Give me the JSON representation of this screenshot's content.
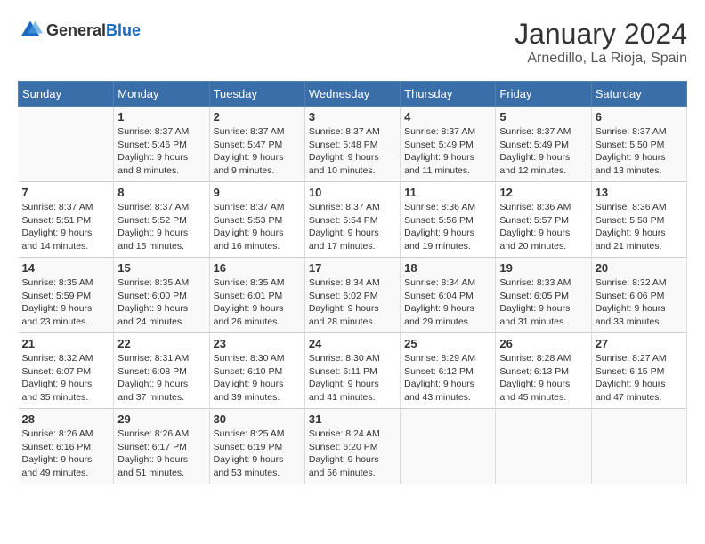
{
  "logo": {
    "text_general": "General",
    "text_blue": "Blue"
  },
  "title": "January 2024",
  "location": "Arnedillo, La Rioja, Spain",
  "weekdays": [
    "Sunday",
    "Monday",
    "Tuesday",
    "Wednesday",
    "Thursday",
    "Friday",
    "Saturday"
  ],
  "weeks": [
    [
      {
        "day": "",
        "info": ""
      },
      {
        "day": "1",
        "info": "Sunrise: 8:37 AM\nSunset: 5:46 PM\nDaylight: 9 hours\nand 8 minutes."
      },
      {
        "day": "2",
        "info": "Sunrise: 8:37 AM\nSunset: 5:47 PM\nDaylight: 9 hours\nand 9 minutes."
      },
      {
        "day": "3",
        "info": "Sunrise: 8:37 AM\nSunset: 5:48 PM\nDaylight: 9 hours\nand 10 minutes."
      },
      {
        "day": "4",
        "info": "Sunrise: 8:37 AM\nSunset: 5:49 PM\nDaylight: 9 hours\nand 11 minutes."
      },
      {
        "day": "5",
        "info": "Sunrise: 8:37 AM\nSunset: 5:49 PM\nDaylight: 9 hours\nand 12 minutes."
      },
      {
        "day": "6",
        "info": "Sunrise: 8:37 AM\nSunset: 5:50 PM\nDaylight: 9 hours\nand 13 minutes."
      }
    ],
    [
      {
        "day": "7",
        "info": "Sunrise: 8:37 AM\nSunset: 5:51 PM\nDaylight: 9 hours\nand 14 minutes."
      },
      {
        "day": "8",
        "info": "Sunrise: 8:37 AM\nSunset: 5:52 PM\nDaylight: 9 hours\nand 15 minutes."
      },
      {
        "day": "9",
        "info": "Sunrise: 8:37 AM\nSunset: 5:53 PM\nDaylight: 9 hours\nand 16 minutes."
      },
      {
        "day": "10",
        "info": "Sunrise: 8:37 AM\nSunset: 5:54 PM\nDaylight: 9 hours\nand 17 minutes."
      },
      {
        "day": "11",
        "info": "Sunrise: 8:36 AM\nSunset: 5:56 PM\nDaylight: 9 hours\nand 19 minutes."
      },
      {
        "day": "12",
        "info": "Sunrise: 8:36 AM\nSunset: 5:57 PM\nDaylight: 9 hours\nand 20 minutes."
      },
      {
        "day": "13",
        "info": "Sunrise: 8:36 AM\nSunset: 5:58 PM\nDaylight: 9 hours\nand 21 minutes."
      }
    ],
    [
      {
        "day": "14",
        "info": "Sunrise: 8:35 AM\nSunset: 5:59 PM\nDaylight: 9 hours\nand 23 minutes."
      },
      {
        "day": "15",
        "info": "Sunrise: 8:35 AM\nSunset: 6:00 PM\nDaylight: 9 hours\nand 24 minutes."
      },
      {
        "day": "16",
        "info": "Sunrise: 8:35 AM\nSunset: 6:01 PM\nDaylight: 9 hours\nand 26 minutes."
      },
      {
        "day": "17",
        "info": "Sunrise: 8:34 AM\nSunset: 6:02 PM\nDaylight: 9 hours\nand 28 minutes."
      },
      {
        "day": "18",
        "info": "Sunrise: 8:34 AM\nSunset: 6:04 PM\nDaylight: 9 hours\nand 29 minutes."
      },
      {
        "day": "19",
        "info": "Sunrise: 8:33 AM\nSunset: 6:05 PM\nDaylight: 9 hours\nand 31 minutes."
      },
      {
        "day": "20",
        "info": "Sunrise: 8:32 AM\nSunset: 6:06 PM\nDaylight: 9 hours\nand 33 minutes."
      }
    ],
    [
      {
        "day": "21",
        "info": "Sunrise: 8:32 AM\nSunset: 6:07 PM\nDaylight: 9 hours\nand 35 minutes."
      },
      {
        "day": "22",
        "info": "Sunrise: 8:31 AM\nSunset: 6:08 PM\nDaylight: 9 hours\nand 37 minutes."
      },
      {
        "day": "23",
        "info": "Sunrise: 8:30 AM\nSunset: 6:10 PM\nDaylight: 9 hours\nand 39 minutes."
      },
      {
        "day": "24",
        "info": "Sunrise: 8:30 AM\nSunset: 6:11 PM\nDaylight: 9 hours\nand 41 minutes."
      },
      {
        "day": "25",
        "info": "Sunrise: 8:29 AM\nSunset: 6:12 PM\nDaylight: 9 hours\nand 43 minutes."
      },
      {
        "day": "26",
        "info": "Sunrise: 8:28 AM\nSunset: 6:13 PM\nDaylight: 9 hours\nand 45 minutes."
      },
      {
        "day": "27",
        "info": "Sunrise: 8:27 AM\nSunset: 6:15 PM\nDaylight: 9 hours\nand 47 minutes."
      }
    ],
    [
      {
        "day": "28",
        "info": "Sunrise: 8:26 AM\nSunset: 6:16 PM\nDaylight: 9 hours\nand 49 minutes."
      },
      {
        "day": "29",
        "info": "Sunrise: 8:26 AM\nSunset: 6:17 PM\nDaylight: 9 hours\nand 51 minutes."
      },
      {
        "day": "30",
        "info": "Sunrise: 8:25 AM\nSunset: 6:19 PM\nDaylight: 9 hours\nand 53 minutes."
      },
      {
        "day": "31",
        "info": "Sunrise: 8:24 AM\nSunset: 6:20 PM\nDaylight: 9 hours\nand 56 minutes."
      },
      {
        "day": "",
        "info": ""
      },
      {
        "day": "",
        "info": ""
      },
      {
        "day": "",
        "info": ""
      }
    ]
  ]
}
